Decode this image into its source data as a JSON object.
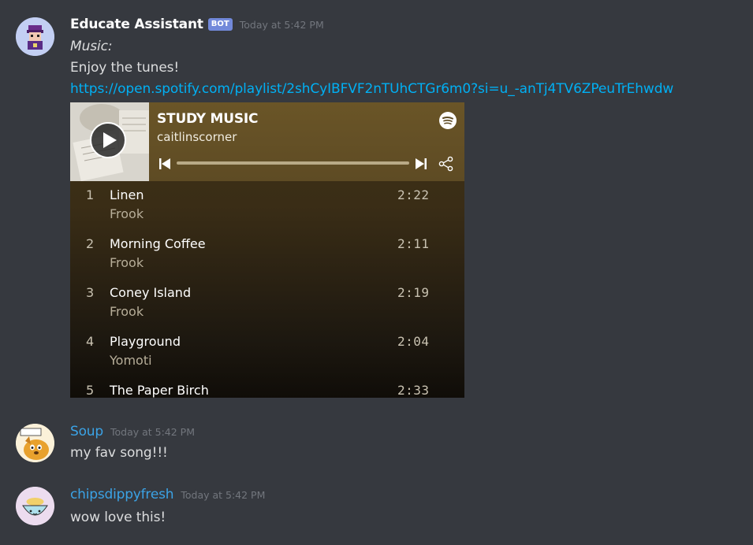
{
  "messages": [
    {
      "username": "Educate Assistant",
      "username_color": "#ffffff",
      "badge": "BOT",
      "timestamp": "Today at 5:42 PM",
      "lines": [
        "Music:",
        "Enjoy the tunes!"
      ],
      "link": "https://open.spotify.com/playlist/2shCyIBFVF2nTUhCTGr6m0?si=u_-anTj4TV6ZPeuTrEhwdw",
      "embed": {
        "title": "STUDY MUSIC",
        "owner": "caitlinscorner",
        "icons": [
          "play-icon",
          "spotify-logo-icon",
          "previous-track-icon",
          "next-track-icon",
          "share-icon"
        ],
        "tracks": [
          {
            "num": "1",
            "name": "Linen",
            "artist": "Frook",
            "duration": "2:22"
          },
          {
            "num": "2",
            "name": "Morning Coffee",
            "artist": "Frook",
            "duration": "2:11"
          },
          {
            "num": "3",
            "name": "Coney Island",
            "artist": "Frook",
            "duration": "2:19"
          },
          {
            "num": "4",
            "name": "Playground",
            "artist": "Yomoti",
            "duration": "2:04"
          },
          {
            "num": "5",
            "name": "The Paper Birch",
            "artist": "",
            "duration": "2:33"
          }
        ]
      }
    },
    {
      "username": "Soup",
      "username_color": "#3ba3e6",
      "timestamp": "Today at 5:42 PM",
      "text": "my fav song!!!"
    },
    {
      "username": "chipsdippyfresh",
      "username_color": "#3ba3e6",
      "timestamp": "Today at 5:42 PM",
      "text": "wow love this!"
    }
  ],
  "colors": {
    "background": "#36393f",
    "timestamp": "#72767d",
    "link": "#00b0f4",
    "bot_badge": "#7289da",
    "text": "#dcddde"
  }
}
